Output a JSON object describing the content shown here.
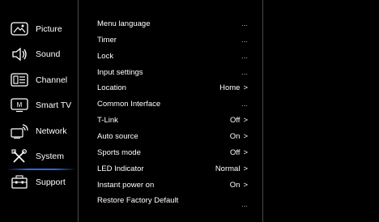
{
  "sidebar": {
    "items": [
      {
        "label": "Picture",
        "icon": "picture-icon"
      },
      {
        "label": "Sound",
        "icon": "speaker-icon"
      },
      {
        "label": "Channel",
        "icon": "channel-icon"
      },
      {
        "label": "Smart TV",
        "icon": "smart-tv-icon"
      },
      {
        "label": "Network",
        "icon": "network-icon"
      },
      {
        "label": "System",
        "icon": "tools-icon"
      },
      {
        "label": "Support",
        "icon": "support-icon"
      }
    ],
    "selected": "System",
    "accent_color": "#2a68d8"
  },
  "menu": {
    "items": [
      {
        "label": "Menu language",
        "value": "...",
        "arrow": ""
      },
      {
        "label": "Timer",
        "value": "...",
        "arrow": ""
      },
      {
        "label": "Lock",
        "value": "...",
        "arrow": ""
      },
      {
        "label": "Input settings",
        "value": "...",
        "arrow": ""
      },
      {
        "label": "Location",
        "value": "Home",
        "arrow": ">"
      },
      {
        "label": "Common Interface",
        "value": "...",
        "arrow": ""
      },
      {
        "label": "T-Link",
        "value": "Off",
        "arrow": ">"
      },
      {
        "label": "Auto source",
        "value": "On",
        "arrow": ">"
      },
      {
        "label": "Sports mode",
        "value": "Off",
        "arrow": ">"
      },
      {
        "label": "LED Indicator",
        "value": "Normal",
        "arrow": ">"
      },
      {
        "label": "Instant power on",
        "value": "On",
        "arrow": ">"
      },
      {
        "label": "Restore Factory Default",
        "value": "...",
        "arrow": ""
      }
    ]
  }
}
